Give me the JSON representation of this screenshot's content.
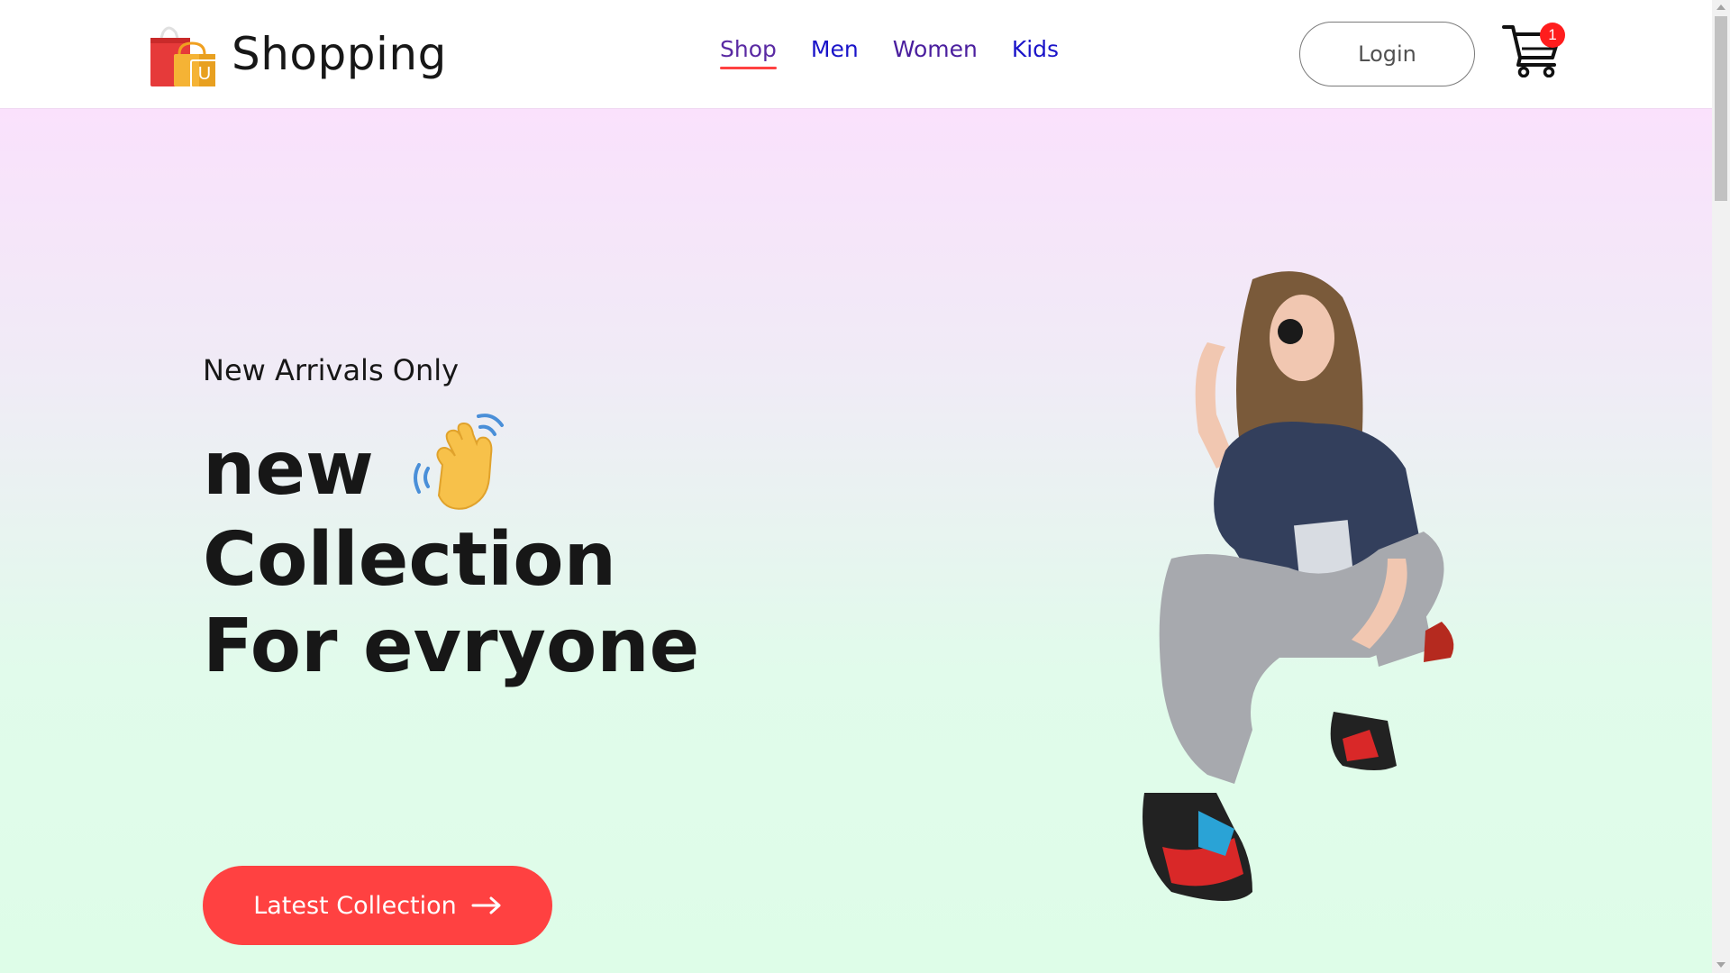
{
  "navbar": {
    "brand": "Shopping",
    "logo_letter": "U",
    "menu": [
      {
        "label": "Shop",
        "active": true
      },
      {
        "label": "Men",
        "active": false
      },
      {
        "label": "Women",
        "active": false
      },
      {
        "label": "Kids",
        "active": false
      }
    ],
    "login_label": "Login",
    "cart_count": "1"
  },
  "hero": {
    "subtitle": "New Arrivals Only",
    "line1": "new",
    "line2": "Collection",
    "line3": "For evryone",
    "cta_label": "Latest Collection"
  },
  "colors": {
    "accent": "#ff4141",
    "nav_link": "#1a14c9",
    "text": "#171717"
  },
  "icons": [
    "shopping-bag-logo-icon",
    "cart-icon",
    "waving-hand-icon",
    "arrow-right-icon"
  ]
}
